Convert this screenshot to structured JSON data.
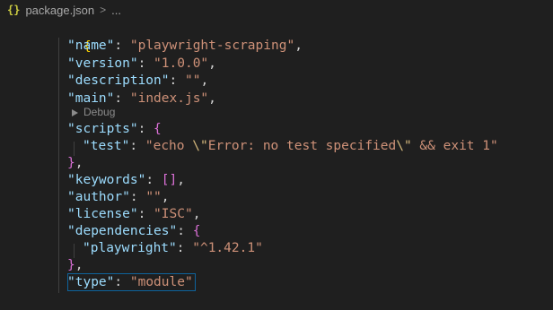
{
  "breadcrumb": {
    "file_icon_glyph": "{}",
    "filename": "package.json",
    "separator": ">",
    "more": "..."
  },
  "editor": {
    "codelens_label": "Debug",
    "lines": {
      "open_brace": "{",
      "name": {
        "key": "\"name\"",
        "colon": ": ",
        "value": "\"playwright-scraping\"",
        "comma": ","
      },
      "version": {
        "key": "\"version\"",
        "colon": ": ",
        "value": "\"1.0.0\"",
        "comma": ","
      },
      "description": {
        "key": "\"description\"",
        "colon": ": ",
        "value": "\"\"",
        "comma": ","
      },
      "main": {
        "key": "\"main\"",
        "colon": ": ",
        "value": "\"index.js\"",
        "comma": ","
      },
      "scripts": {
        "key": "\"scripts\"",
        "colon": ": ",
        "open": "{"
      },
      "test": {
        "key": "\"test\"",
        "colon": ": ",
        "v1": "\"echo ",
        "e1": "\\\"",
        "v2": "Error: no test specified",
        "e2": "\\\"",
        "v3": " && exit 1\""
      },
      "scripts_close": {
        "close": "}",
        "comma": ","
      },
      "keywords": {
        "key": "\"keywords\"",
        "colon": ": ",
        "value": "[]",
        "comma": ","
      },
      "author": {
        "key": "\"author\"",
        "colon": ": ",
        "value": "\"\"",
        "comma": ","
      },
      "license": {
        "key": "\"license\"",
        "colon": ": ",
        "value": "\"ISC\"",
        "comma": ","
      },
      "dependencies": {
        "key": "\"dependencies\"",
        "colon": ": ",
        "open": "{"
      },
      "playwright": {
        "key": "\"playwright\"",
        "colon": ": ",
        "value": "\"^1.42.1\""
      },
      "dependencies_close": {
        "close": "}",
        "comma": ","
      },
      "type": {
        "key": "\"type\"",
        "colon": ": ",
        "value": "\"module\""
      },
      "close_brace": "}"
    }
  },
  "colors": {
    "background": "#1f1f1f",
    "key": "#9cdcfe",
    "string": "#ce9178",
    "bracket_level1": "#ffd700",
    "bracket_level2": "#da70d6",
    "bracket_level3": "#179fff",
    "escape": "#d7ba7d",
    "selection_border": "#0e639c"
  }
}
